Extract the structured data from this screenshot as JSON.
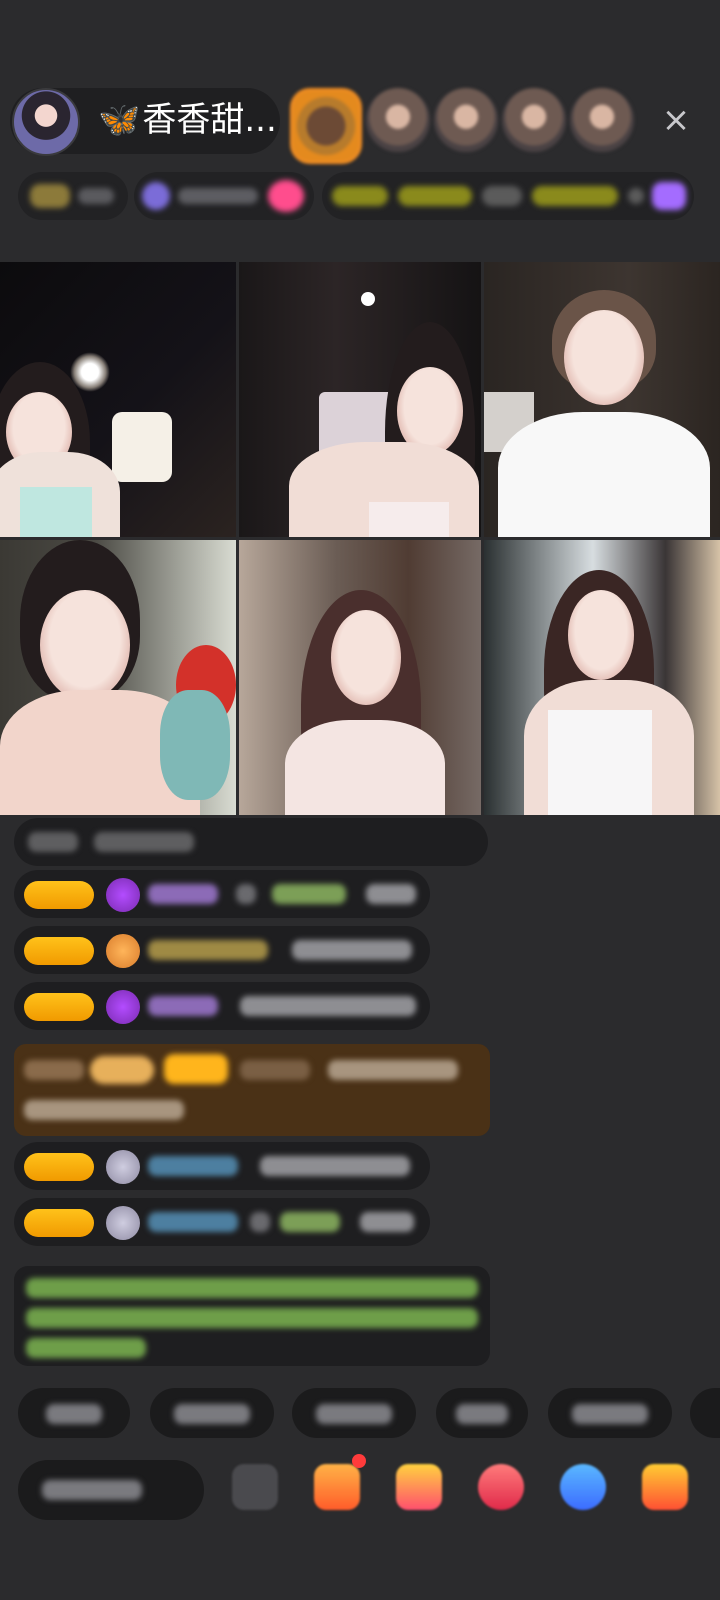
{
  "header": {
    "host_name": "香香甜...",
    "butterfly_icon": "butterfly-icon",
    "close_icon": "×",
    "viewers": [
      {
        "name": "viewer-1"
      },
      {
        "name": "viewer-2"
      },
      {
        "name": "viewer-3"
      },
      {
        "name": "viewer-4"
      },
      {
        "name": "viewer-5"
      }
    ]
  },
  "colors": {
    "background": "#2b2b2d",
    "pill": "#1f1f21",
    "accent_orange": "#f08d24",
    "level_badge": "#ffc21a",
    "gift_card": "#4a3116",
    "pink": "#ff4d8d"
  }
}
